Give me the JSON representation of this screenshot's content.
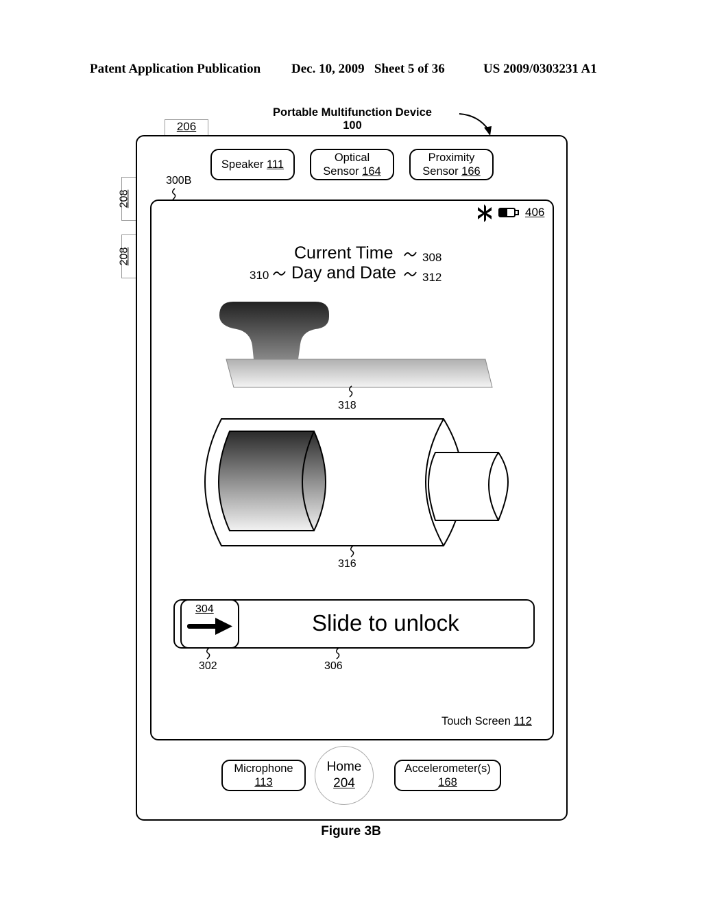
{
  "header": {
    "publication": "Patent Application Publication",
    "date_sheet": "Dec. 10, 2009   Sheet 5 of 36",
    "patent_number": "US 2009/0303231 A1"
  },
  "figure": {
    "device_title": "Portable Multifunction Device",
    "device_ref": "100",
    "caption": "Figure 3B",
    "screen_ref": "300B"
  },
  "hardware": {
    "top_button_ref": "206",
    "side_buttons": [
      "208",
      "208"
    ],
    "speaker": {
      "label": "Speaker",
      "ref": "111"
    },
    "optical_sensor": {
      "label1": "Optical",
      "label2": "Sensor",
      "ref": "164"
    },
    "proximity_sensor": {
      "label1": "Proximity",
      "label2": "Sensor",
      "ref": "166"
    },
    "microphone": {
      "label": "Microphone",
      "ref": "113"
    },
    "home": {
      "label": "Home",
      "ref": "204"
    },
    "accelerometer": {
      "label": "Accelerometer(s)",
      "ref": "168"
    }
  },
  "screen": {
    "status_ref": "406",
    "status_icons": [
      "bluetooth-icon",
      "battery-icon"
    ],
    "current_time": "Current Time",
    "current_time_ref": "308",
    "day_date": "Day and Date",
    "day_date_ref_left": "310",
    "day_date_ref_right": "312",
    "charger_image_ref": "318",
    "battery_image_ref": "316",
    "unlock": {
      "label": "Slide to unlock",
      "handle_ref": "304",
      "image_ref": "302",
      "track_ref": "306"
    },
    "touch_screen": {
      "label": "Touch Screen",
      "ref": "112"
    }
  }
}
